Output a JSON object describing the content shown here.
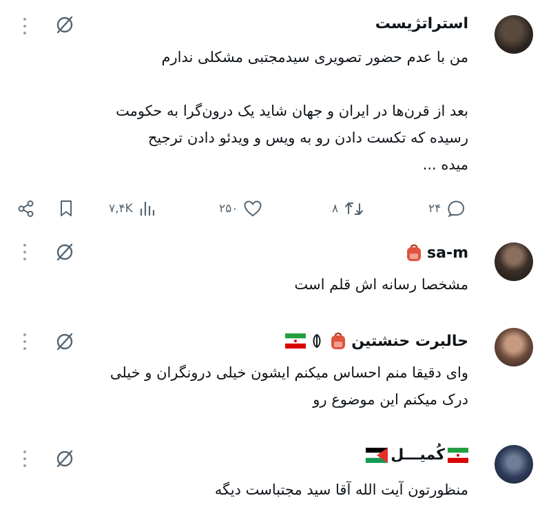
{
  "posts": [
    {
      "author": "استراتژیست",
      "body_lines": [
        "من با عدم حضور تصویری سیدمجتبی مشکلی ندارم"
      ],
      "body2_lines": [
        "بعد از قرن‌ها در ایران و جهان شاید یک درون‌گرا به حکومت",
        "رسیده که تکست دادن رو به ویس و ویدئو دادن ترجیح",
        "میده ..."
      ],
      "stats": {
        "replies": "۲۴",
        "reposts": "۸",
        "likes": "۲۵۰",
        "views": "۷,۴K"
      }
    },
    {
      "author": "sa-m",
      "body_lines": [
        "مشخصا رسانه اش قلم است"
      ]
    },
    {
      "author": "حالبرت حنشتین",
      "body_lines": [
        "وای دقیقا منم احساس میکنم ایشون خیلی درونگران و خیلی",
        "درک میکنم این موضوع رو"
      ]
    },
    {
      "author": "کُمیـــل",
      "body_lines": [
        "منظورتون آیت الله آقا سید مجتباست دیگه"
      ]
    }
  ],
  "icons": {
    "menu": "more-vertical-icon",
    "grok": "grok-icon",
    "reply": "reply-icon",
    "repost": "repost-icon",
    "like": "heart-icon",
    "views": "views-icon",
    "bookmark": "bookmark-icon",
    "share": "share-icon"
  },
  "colors": {
    "text": "#0f1419",
    "muted": "#536471",
    "background": "#ffffff"
  }
}
